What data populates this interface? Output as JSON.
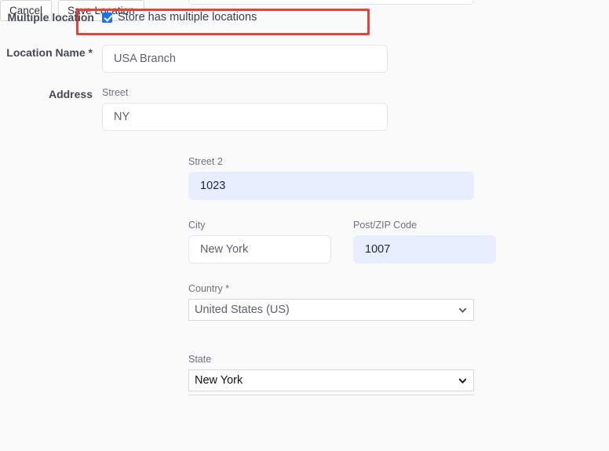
{
  "form": {
    "multiple_location": {
      "label": "Multiple location",
      "checkbox_label": "Store has multiple locations",
      "checked": true,
      "highlight_color": "#e8403a"
    },
    "location_name": {
      "label": "Location Name *",
      "value": "USA Branch",
      "placeholder": ""
    },
    "address": {
      "label": "Address",
      "street": {
        "label": "Street",
        "value": "NY",
        "placeholder": ""
      },
      "street2": {
        "label": "Street 2",
        "value": "1023",
        "placeholder": "",
        "autofilled": true,
        "autofill_color": "#e8eefe"
      },
      "city": {
        "label": "City",
        "value": "New York",
        "placeholder": ""
      },
      "postcode": {
        "label": "Post/ZIP Code",
        "value": "1007",
        "placeholder": "",
        "autofilled": true,
        "autofill_color": "#e8eefe"
      },
      "country": {
        "label": "Country *",
        "value": "United States (US)",
        "options": [
          "United States (US)"
        ]
      },
      "state": {
        "label": "State",
        "value": "New York",
        "options": [
          "New York"
        ]
      }
    },
    "actions": {
      "cancel_label": "Cancel",
      "save_label": "Save Location"
    }
  },
  "icons": {
    "checkmark": "checkmark-icon",
    "chevron_down": "chevron-down-icon"
  }
}
